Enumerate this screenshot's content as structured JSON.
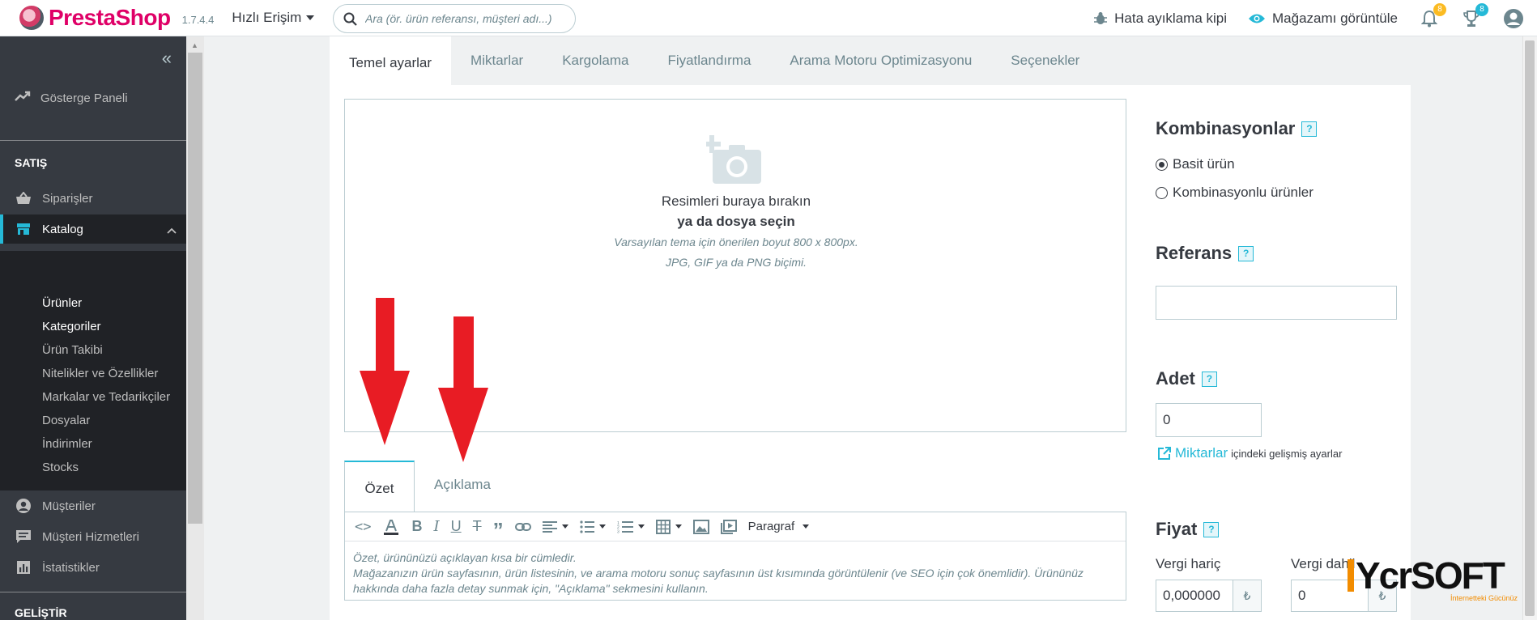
{
  "header": {
    "brand_main": "Presta",
    "brand_sub": "Shop",
    "version": "1.7.4.4",
    "quick_access": "Hızlı Erişim",
    "search_placeholder": "Ara (ör. ürün referansı, müşteri adı...)",
    "debug_mode": "Hata ayıklama kipi",
    "view_store": "Mağazamı görüntüle",
    "notif_count": "8",
    "trophy_count": "8"
  },
  "sidebar": {
    "collapse": "«",
    "dashboard": "Gösterge Paneli",
    "section_sales": "SATIŞ",
    "orders": "Siparişler",
    "catalog": "Katalog",
    "catalog_items": [
      "Ürünler",
      "Kategoriler",
      "Ürün Takibi",
      "Nitelikler ve Özellikler",
      "Markalar ve Tedarikçiler",
      "Dosyalar",
      "İndirimler",
      "Stocks"
    ],
    "customers": "Müşteriler",
    "customer_service": "Müşteri Hizmetleri",
    "stats": "İstatistikler",
    "section_develop": "GELİŞTİR"
  },
  "tabs": [
    "Temel ayarlar",
    "Miktarlar",
    "Kargolama",
    "Fiyatlandırma",
    "Arama Motoru Optimizasyonu",
    "Seçenekler"
  ],
  "dropzone": {
    "line1": "Resimleri buraya bırakın",
    "line2": "ya da dosya seçin",
    "line3": "Varsayılan tema için önerilen boyut 800 x 800px.",
    "line4": "JPG, GIF ya da PNG biçimi."
  },
  "editor": {
    "tab_summary": "Özet",
    "tab_description": "Açıklama",
    "format": "Paragraf",
    "placeholder_line1": "Özet, ürününüzü açıklayan kısa bir cümledir.",
    "placeholder_line2": "Mağazanızın ürün sayfasının, ürün listesinin, ve arama motoru sonuç sayfasının üst kısımında görüntülenir (ve SEO için çok önemlidir). Ürününüz hakkında daha fazla detay sunmak için, \"Açıklama\" sekmesini kullanın."
  },
  "right": {
    "combinations_title": "Kombinasyonlar",
    "simple_product": "Basit ürün",
    "with_combinations": "Kombinasyonlu ürünler",
    "reference_title": "Referans",
    "reference_value": "",
    "quantity_title": "Adet",
    "quantity_value": "0",
    "quantities_link": "Miktarlar",
    "quantities_rest": "içindeki gelişmiş ayarlar",
    "price_title": "Fiyat",
    "tax_excl": "Vergi hariç",
    "tax_incl": "Vergi dahil",
    "price_excl_value": "0,000000",
    "price_incl_value": "0",
    "currency": "₺"
  },
  "help_mark": "?",
  "watermark": {
    "brand": "YcrSOFT",
    "tagline": "İnternetteki Gücünüz"
  },
  "colors": {
    "accent": "#25b9d7",
    "brand": "#df0067",
    "sidebar_bg": "#363a41",
    "arrow": "#e81c24"
  }
}
